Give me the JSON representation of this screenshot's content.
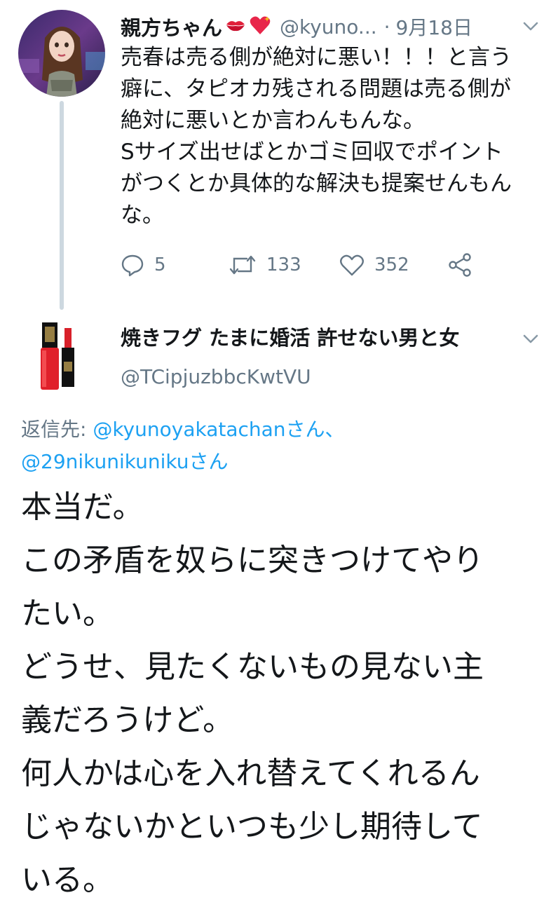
{
  "tweet1": {
    "display_name": "親方ちゃん",
    "handle": "@kyuno...",
    "separator": "·",
    "date": "9月18日",
    "body_lines": [
      "売春は売る側が絶対に悪い！！！と言う",
      "癖に、タピオカ残される問題は売る側が",
      "絶対に悪いとか言わんもんな。",
      "Sサイズ出せばとかゴミ回収でポイント",
      "がつくとか具体的な解決も提案せんもん",
      "な。"
    ],
    "actions": {
      "reply_count": "5",
      "retweet_count": "133",
      "like_count": "352"
    },
    "icons": [
      "kiss-mark-emoji",
      "sparkling-heart-emoji",
      "chevron-down-icon",
      "reply-icon",
      "retweet-icon",
      "heart-icon",
      "share-icon"
    ]
  },
  "tweet2": {
    "display_name": "焼きフグ たまに婚活 許せない男と女",
    "handle": "@TCipjuzbbcKwtVU",
    "reply_prefix": "返信先: ",
    "reply_user1": "@kyunoyakatachan",
    "reply_suffix1": "さん、",
    "reply_user2": "@29nikunikuniku",
    "reply_suffix2": "さん",
    "body_lines": [
      "本当だ。",
      "この矛盾を奴らに突きつけてやり",
      "たい。",
      "どうせ、見たくないもの見ない主",
      "義だろうけど。",
      "何人かは心を入れ替えてくれるん",
      "じゃないかといつも少し期待して",
      "いる。"
    ]
  },
  "colors": {
    "text": "#14171a",
    "muted": "#657786",
    "link": "#1da1f2",
    "thread_line": "#cdd8e0"
  }
}
